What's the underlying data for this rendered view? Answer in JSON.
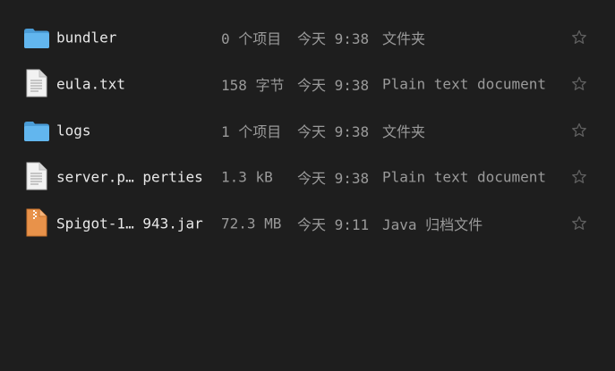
{
  "files": [
    {
      "name": "bundler",
      "size": "0 个项目",
      "modified": "今天 9:38",
      "type": "文件夹",
      "icon": "folder-icon"
    },
    {
      "name": "eula.txt",
      "size": "158 字节",
      "modified": "今天 9:38",
      "type": "Plain text document",
      "icon": "text-file-icon"
    },
    {
      "name": "logs",
      "size": "1 个项目",
      "modified": "今天 9:38",
      "type": "文件夹",
      "icon": "folder-icon"
    },
    {
      "name": "server.p… perties",
      "size": "1.3 kB",
      "modified": "今天 9:38",
      "type": "Plain text document",
      "icon": "text-file-icon"
    },
    {
      "name": "Spigot-1… 943.jar",
      "size": "72.3 MB",
      "modified": "今天 9:11",
      "type": "Java 归档文件",
      "icon": "archive-file-icon"
    }
  ],
  "colors": {
    "background": "#1e1e1e",
    "folder": "#5aaee6",
    "archive": "#e8924a",
    "text_primary": "#e8e8e8",
    "text_secondary": "#9a9a9a"
  }
}
